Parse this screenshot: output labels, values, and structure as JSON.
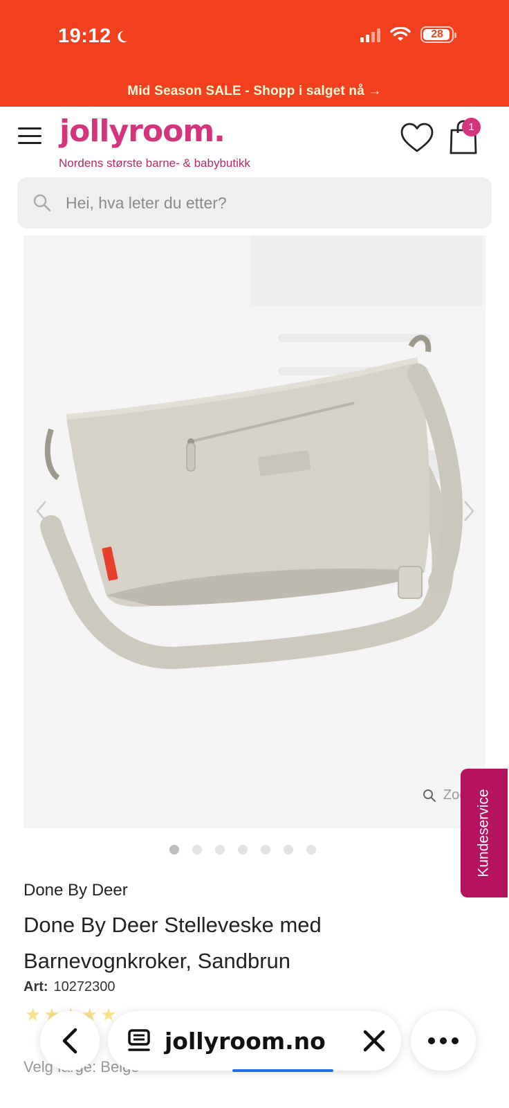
{
  "status_bar": {
    "time": "19:12",
    "battery": "28",
    "icons": [
      "moon-icon",
      "cellular-signal-icon",
      "wifi-icon",
      "battery-icon"
    ]
  },
  "promo": {
    "text": "Mid Season SALE - Shopp i salget nå →"
  },
  "header": {
    "logo": "jollyroom.",
    "tagline": "Nordens største barne- & babybutikk",
    "cart_count": "1",
    "icons": [
      "hamburger-menu-icon",
      "heart-icon",
      "shopping-bag-icon"
    ]
  },
  "search": {
    "placeholder": "Hei, hva leter du etter?"
  },
  "gallery": {
    "zoom_label": "Zoom",
    "slide_count": 7,
    "active_slide": 1
  },
  "customer_service": {
    "label": "Kundeservice"
  },
  "product": {
    "brand": "Done By Deer",
    "title": "Done By Deer Stelleveske med Barnevognkroker, Sandbrun",
    "art_label": "Art:",
    "art_number": "10272300",
    "color_label": "Velg farge: Beige"
  },
  "browser": {
    "url": "jollyroom.no",
    "load_progress": 0.35
  },
  "colors": {
    "accent_orange": "#f2401f",
    "brand_pink": "#d6337d",
    "service_magenta": "#b5135f"
  }
}
